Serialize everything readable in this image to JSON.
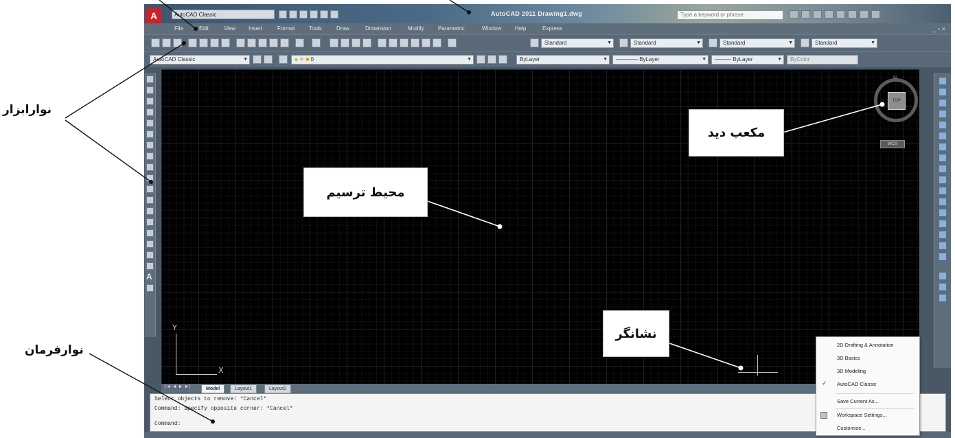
{
  "window": {
    "app_title": "AutoCAD 2011  Drawing1.dwg",
    "workspace_combo": "AutoCAD Classic",
    "search_placeholder": "Type a keyword or phrase",
    "app_logo": "A"
  },
  "menu": [
    "File",
    "Edit",
    "View",
    "Insert",
    "Format",
    "Tools",
    "Draw",
    "Dimension",
    "Modify",
    "Parametric",
    "Window",
    "Help",
    "Express"
  ],
  "styles_toolbar": {
    "text_style": "Standard",
    "dim_style": "Standard",
    "table_style": "Standard",
    "multileader_style": "Standard"
  },
  "layers_toolbar": {
    "workspace": "AutoCAD Classic",
    "layer": "0",
    "color": "ByLayer",
    "linetype": "ByLayer",
    "lineweight": "ByLayer",
    "plotstyle": "ByColor"
  },
  "viewcube": {
    "north": "N",
    "face": "TOP",
    "wcs_button": "WCS"
  },
  "ucs": {
    "x_label": "X",
    "y_label": "Y"
  },
  "layout_tabs": {
    "nav": "|◄ ◄ ► ►|",
    "tabs": [
      "Model",
      "Layout1",
      "Layout2"
    ]
  },
  "command_lines": [
    "Select objects to remove: *Cancel*",
    "Command: Specify opposite corner: *Cancel*",
    "Command:"
  ],
  "workspace_menu": {
    "items": [
      "2D Drafting & Annotation",
      "3D Basics",
      "3D Modeling",
      "AutoCAD Classic"
    ],
    "checked": "AutoCAD Classic",
    "actions": [
      "Save Current As...",
      "Workspace Settings...",
      "Customize..."
    ]
  },
  "callouts": {
    "toolbar": "نوارابزار",
    "drawing_area": "محیط ترسیم",
    "viewcube": "مکعب دید",
    "cursor": "نشانگر",
    "command_bar": "نوارفرمان"
  },
  "colors": {
    "canvas": "#000000",
    "frame": "#4a5866",
    "logo": "#c8222a"
  }
}
